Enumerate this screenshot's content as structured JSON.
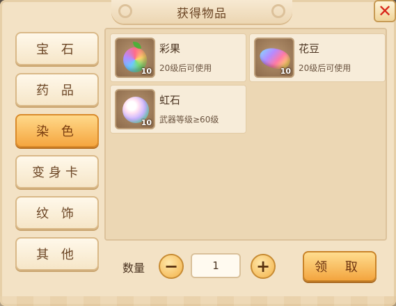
{
  "dialog": {
    "title": "获得物品",
    "close_icon": "close-icon",
    "close_glyph": "✕"
  },
  "sidebar": {
    "items": [
      {
        "label": "宝 石",
        "active": false
      },
      {
        "label": "药 品",
        "active": false
      },
      {
        "label": "染 色",
        "active": true
      },
      {
        "label": "变身卡",
        "active": false
      },
      {
        "label": "纹 饰",
        "active": false
      },
      {
        "label": "其 他",
        "active": false
      }
    ]
  },
  "items": [
    {
      "name": "彩果",
      "desc": "20级后可使用",
      "count": "10",
      "icon": "rainbow-fruit-icon"
    },
    {
      "name": "花豆",
      "desc": "20级后可使用",
      "count": "10",
      "icon": "rainbow-bean-icon"
    },
    {
      "name": "虹石",
      "desc": "武器等级≥60级",
      "count": "10",
      "icon": "rainbow-stone-icon"
    }
  ],
  "quantity": {
    "label": "数量",
    "value": "1",
    "minus_glyph": "−",
    "plus_glyph": "+"
  },
  "claim_label": "领 取",
  "colors": {
    "panel_bg": "#f3e2c5",
    "active_tab": "#f5a640",
    "close_red": "#d8261a"
  }
}
